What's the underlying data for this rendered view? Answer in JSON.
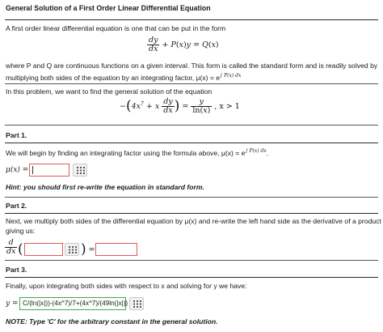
{
  "title": "General Solution of a First Order Linear Differential Equation",
  "intro": "A first order linear differential equation is one that can be put in the form",
  "where_line1": "where P and Q are continuous functions on a given interval. This form is called the standard form and is readily solved by",
  "where_line2": "multiplying both sides of the equation by an integrating factor, μ(x) = e",
  "where_exp": "∫ P(x) dx",
  "problem_text": "In this problem, we want to find the general solution of the equation",
  "problem_condition": ", x > 1",
  "part1": {
    "heading": "Part 1.",
    "text": "We will begin by finding an integrating factor using the formula above, μ(x) = e",
    "exp": "∫ P(x) dx",
    "label": "μ(x) =",
    "hint": "Hint: you should first re-write the equation in standard form."
  },
  "part2": {
    "heading": "Part 2.",
    "text1": "Next, we multiply both sides of the differential equation by μ(x) and re-write the left hand side as the derivative of a product",
    "text2": "giving us:"
  },
  "part3": {
    "heading": "Part 3.",
    "text": "Finally, upon integrating both sides with respect to x and solving for y we have:",
    "label": "y =",
    "answer_value": "C/(ln(|x|))-(4x^7)/7+(4x^7)/(49ln(|x|))",
    "note": "NOTE: Type 'C' for the arbitrary constant in the general solution."
  },
  "colors": {
    "error_border": "#e05a5a",
    "ok_border": "#4aa44a",
    "rule": "#2b2b2b"
  }
}
